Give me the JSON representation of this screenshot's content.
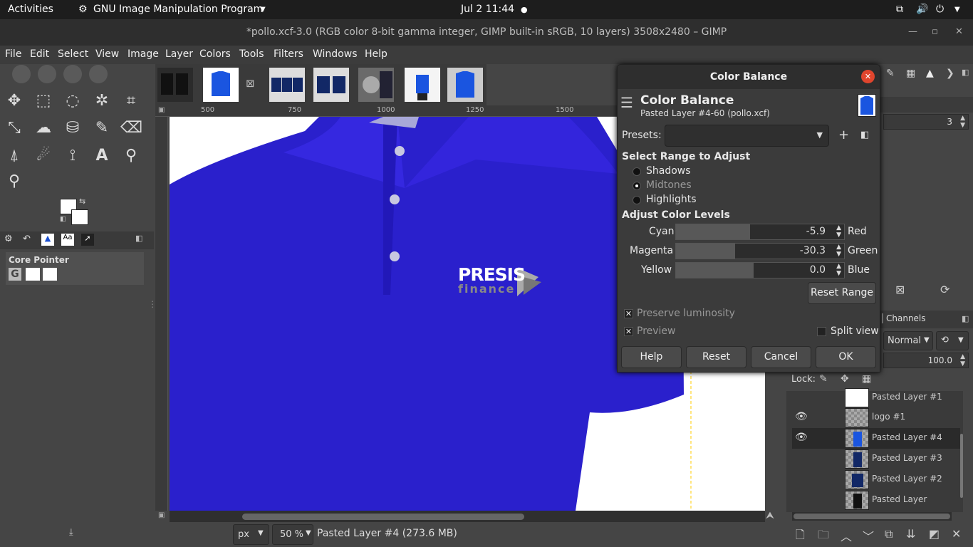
{
  "topbar": {
    "activities": "Activities",
    "app": "GNU Image Manipulation Program",
    "clock": "Jul 2  11:44"
  },
  "window": {
    "title": "*pollo.xcf-3.0 (RGB color 8-bit gamma integer, GIMP built-in sRGB, 10 layers) 3508x2480 – GIMP"
  },
  "menu": [
    "File",
    "Edit",
    "Select",
    "View",
    "Image",
    "Layer",
    "Colors",
    "Tools",
    "Filters",
    "Windows",
    "Help"
  ],
  "toolbox": {
    "tool_options_title": "Core Pointer"
  },
  "ruler": {
    "ticks": [
      "500",
      "750",
      "1000",
      "1250",
      "1500"
    ]
  },
  "artwork": {
    "logo_line1": "PRESIS",
    "logo_line2": "finance"
  },
  "statusbar": {
    "unit": "px",
    "zoom": "50 %",
    "layer_info": "Pasted Layer #4 (273.6 MB)"
  },
  "dialog": {
    "window_title": "Color Balance",
    "header_title": "Color Balance",
    "header_sub": "Pasted Layer #4-60 (pollo.xcf)",
    "presets_label": "Presets:",
    "presets_value": "",
    "range_title": "Select Range to Adjust",
    "ranges": [
      "Shadows",
      "Midtones",
      "Highlights"
    ],
    "selected_range": "Midtones",
    "levels_title": "Adjust Color Levels",
    "sliders": [
      {
        "left": "Cyan",
        "right": "Red",
        "value": "-5.9",
        "fraction": 0.44
      },
      {
        "left": "Magenta",
        "right": "Green",
        "value": "-30.3",
        "fraction": 0.35
      },
      {
        "left": "Yellow",
        "right": "Blue",
        "value": "0.0",
        "fraction": 0.46
      }
    ],
    "reset_range": "Reset Range",
    "preserve_luminosity": "Preserve luminosity",
    "preview": "Preview",
    "split_view": "Split view",
    "buttons": {
      "help": "Help",
      "reset": "Reset",
      "cancel": "Cancel",
      "ok": "OK"
    }
  },
  "right_panel": {
    "spin_value": "3",
    "channels_tab": "Channels",
    "mode": "Normal",
    "opacity": "100.0",
    "lock_label": "Lock:",
    "layers": [
      {
        "name": "Pasted Layer #1",
        "visible": false
      },
      {
        "name": "logo #1",
        "visible": true
      },
      {
        "name": "Pasted Layer #4",
        "visible": true
      },
      {
        "name": "Pasted Layer #3",
        "visible": false
      },
      {
        "name": "Pasted Layer #2",
        "visible": false
      },
      {
        "name": "Pasted Layer",
        "visible": false
      }
    ]
  }
}
